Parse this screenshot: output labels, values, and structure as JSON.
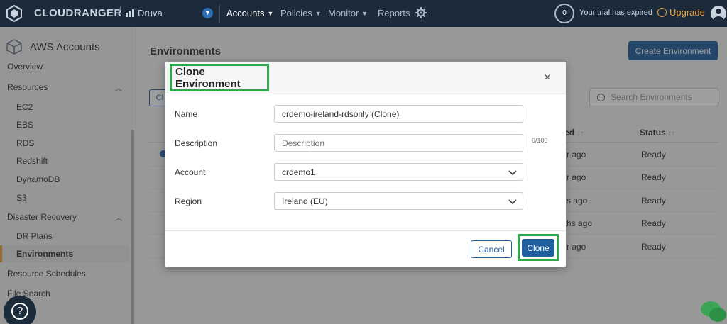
{
  "topnav": {
    "brand": "CLOUDRANGER",
    "separator": "/",
    "org": "Druva",
    "nav": [
      {
        "label": "Accounts",
        "active": true,
        "has_caret": true
      },
      {
        "label": "Policies",
        "active": false,
        "has_caret": true
      },
      {
        "label": "Monitor",
        "active": false,
        "has_caret": true
      },
      {
        "label": "Reports",
        "active": false,
        "has_caret": false
      }
    ],
    "trial_count": "0",
    "trial_text": "Your trial has expired",
    "upgrade_label": "Upgrade"
  },
  "sidebar": {
    "title": "AWS Accounts",
    "items": [
      {
        "label": "Overview",
        "level": 0
      },
      {
        "label": "Resources",
        "level": 0,
        "expandable": true
      },
      {
        "label": "EC2",
        "level": 1
      },
      {
        "label": "EBS",
        "level": 1
      },
      {
        "label": "RDS",
        "level": 1
      },
      {
        "label": "Redshift",
        "level": 1
      },
      {
        "label": "DynamoDB",
        "level": 1
      },
      {
        "label": "S3",
        "level": 1
      },
      {
        "label": "Disaster Recovery",
        "level": 0,
        "expandable": true
      },
      {
        "label": "DR Plans",
        "level": 1
      },
      {
        "label": "Environments",
        "level": 1,
        "active": true
      },
      {
        "label": "Resource Schedules",
        "level": 0
      },
      {
        "label": "File Search",
        "level": 0
      }
    ]
  },
  "main": {
    "title": "Environments",
    "create_button": "Create Environment",
    "partial_button": "Cl",
    "search_placeholder": "Search Environments",
    "columns": [
      {
        "label": "ed",
        "sortable": true
      },
      {
        "label": "Status",
        "sortable": true
      }
    ],
    "rows": [
      {
        "created": "r ago",
        "status": "Ready"
      },
      {
        "created": "r ago",
        "status": "Ready"
      },
      {
        "created": "rs ago",
        "status": "Ready"
      },
      {
        "created": "nths ago",
        "status": "Ready"
      },
      {
        "created": "r ago",
        "status": "Ready"
      }
    ]
  },
  "modal": {
    "title": "Clone Environment",
    "close": "×",
    "fields": {
      "name": {
        "label": "Name",
        "value": "crdemo-ireland-rdsonly (Clone)"
      },
      "description": {
        "label": "Description",
        "value": "",
        "placeholder": "Description",
        "counter": "0/100"
      },
      "account": {
        "label": "Account",
        "value": "crdemo1"
      },
      "region": {
        "label": "Region",
        "value": "Ireland (EU)"
      }
    },
    "cancel_label": "Cancel",
    "clone_label": "Clone"
  },
  "help": {
    "label": "?"
  },
  "colors": {
    "nav_bg": "#1c2b3c",
    "primary": "#1f5f9e",
    "accent": "#e8a33b",
    "highlight": "#2ea84a"
  }
}
